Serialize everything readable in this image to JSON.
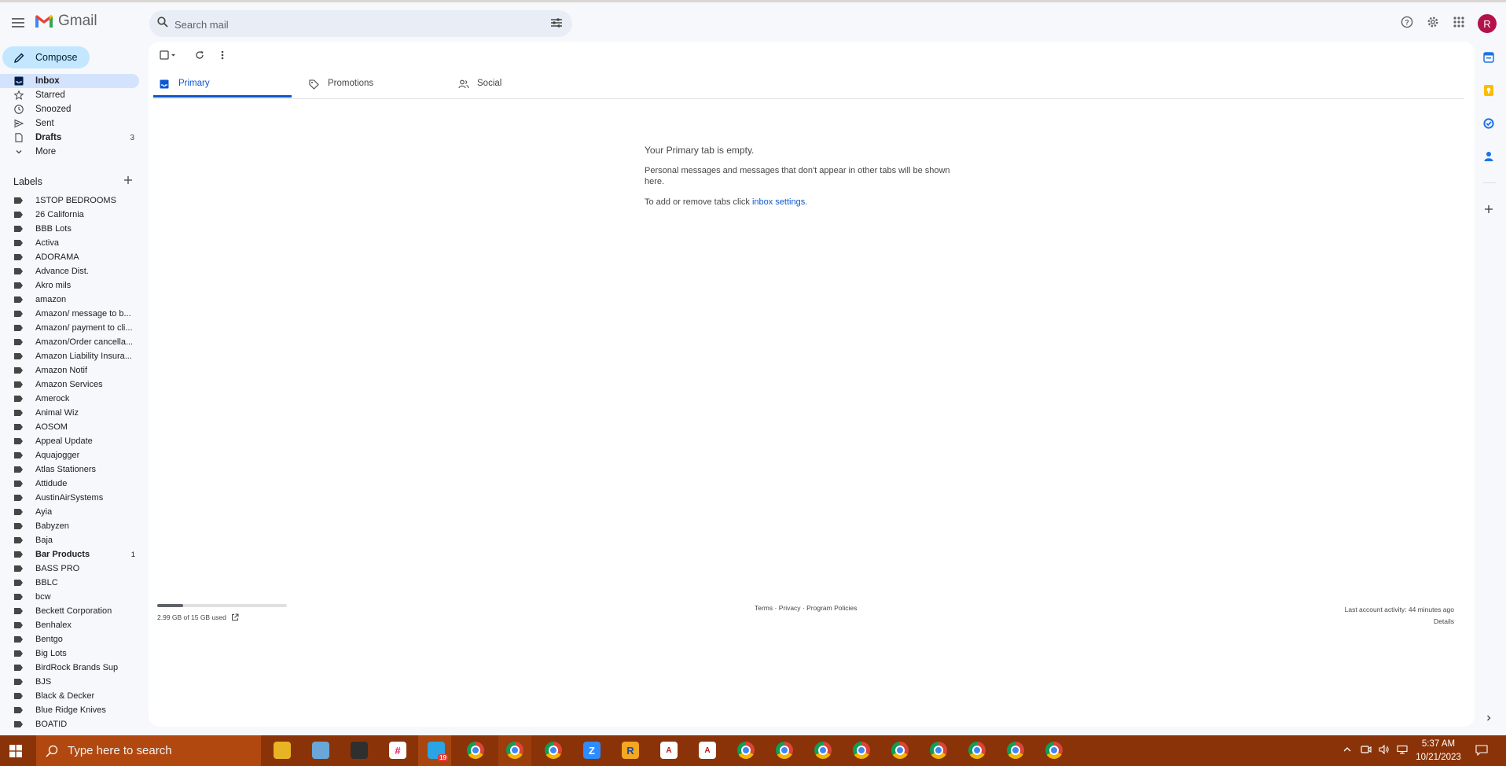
{
  "app": {
    "name": "Gmail"
  },
  "search": {
    "placeholder": "Search mail"
  },
  "header": {
    "avatar_letter": "R"
  },
  "compose": {
    "label": "Compose"
  },
  "nav": [
    {
      "label": "Inbox",
      "icon": "inbox-icon",
      "count": "",
      "active": true,
      "bold": true
    },
    {
      "label": "Starred",
      "icon": "star-icon",
      "count": ""
    },
    {
      "label": "Snoozed",
      "icon": "clock-icon",
      "count": ""
    },
    {
      "label": "Sent",
      "icon": "send-icon",
      "count": ""
    },
    {
      "label": "Drafts",
      "icon": "draft-icon",
      "count": "3",
      "bold": true
    },
    {
      "label": "More",
      "icon": "chevron-down-icon",
      "count": ""
    }
  ],
  "labels": {
    "heading": "Labels",
    "items": [
      {
        "label": "1STOP BEDROOMS",
        "count": ""
      },
      {
        "label": "26 California",
        "count": ""
      },
      {
        "label": "BBB Lots",
        "count": ""
      },
      {
        "label": "Activa",
        "count": ""
      },
      {
        "label": "ADORAMA",
        "count": ""
      },
      {
        "label": "Advance Dist.",
        "count": ""
      },
      {
        "label": "Akro mils",
        "count": ""
      },
      {
        "label": "amazon",
        "count": ""
      },
      {
        "label": "Amazon/ message to b...",
        "count": ""
      },
      {
        "label": "Amazon/ payment to cli...",
        "count": ""
      },
      {
        "label": "Amazon/Order cancella...",
        "count": ""
      },
      {
        "label": "Amazon Liability Insura...",
        "count": ""
      },
      {
        "label": "Amazon Notif",
        "count": ""
      },
      {
        "label": "Amazon Services",
        "count": ""
      },
      {
        "label": "Amerock",
        "count": ""
      },
      {
        "label": "Animal Wiz",
        "count": ""
      },
      {
        "label": "AOSOM",
        "count": ""
      },
      {
        "label": "Appeal Update",
        "count": ""
      },
      {
        "label": "Aquajogger",
        "count": ""
      },
      {
        "label": "Atlas Stationers",
        "count": ""
      },
      {
        "label": "Attidude",
        "count": ""
      },
      {
        "label": "AustinAirSystems",
        "count": ""
      },
      {
        "label": "Ayia",
        "count": ""
      },
      {
        "label": "Babyzen",
        "count": ""
      },
      {
        "label": "Baja",
        "count": ""
      },
      {
        "label": "Bar Products",
        "count": "1",
        "bold": true
      },
      {
        "label": "BASS PRO",
        "count": ""
      },
      {
        "label": "BBLC",
        "count": ""
      },
      {
        "label": "bcw",
        "count": ""
      },
      {
        "label": "Beckett Corporation",
        "count": ""
      },
      {
        "label": "Benhalex",
        "count": ""
      },
      {
        "label": "Bentgo",
        "count": ""
      },
      {
        "label": "Big Lots",
        "count": ""
      },
      {
        "label": "BirdRock Brands Sup",
        "count": ""
      },
      {
        "label": "BJS",
        "count": ""
      },
      {
        "label": "Black & Decker",
        "count": ""
      },
      {
        "label": "Blue Ridge Knives",
        "count": ""
      },
      {
        "label": "BOATID",
        "count": ""
      }
    ]
  },
  "tabs": [
    {
      "label": "Primary",
      "icon": "inbox-tab-icon",
      "active": true
    },
    {
      "label": "Promotions",
      "icon": "tag-icon"
    },
    {
      "label": "Social",
      "icon": "people-icon"
    }
  ],
  "empty_state": {
    "title": "Your Primary tab is empty.",
    "line1": "Personal messages and messages that don't appear in other tabs will be shown here.",
    "line2_prefix": "To add or remove tabs click ",
    "line2_link": "inbox settings",
    "line2_suffix": "."
  },
  "storage": {
    "text": "2.99 GB of 15 GB used",
    "fraction": 0.2
  },
  "footer": {
    "policies": "Terms · Privacy · Program Policies",
    "activity": "Last account activity: 44 minutes ago",
    "details": "Details"
  },
  "taskbar": {
    "search_placeholder": "Type here to search",
    "time": "5:37 AM",
    "date": "10/21/2023",
    "mail_badge": "19"
  },
  "colors": {
    "accent": "#0b57d0",
    "compose_bg": "#c2e7ff",
    "active_nav": "#d3e3fd",
    "taskbar": "#8a3308",
    "avatar": "#b3124a"
  }
}
